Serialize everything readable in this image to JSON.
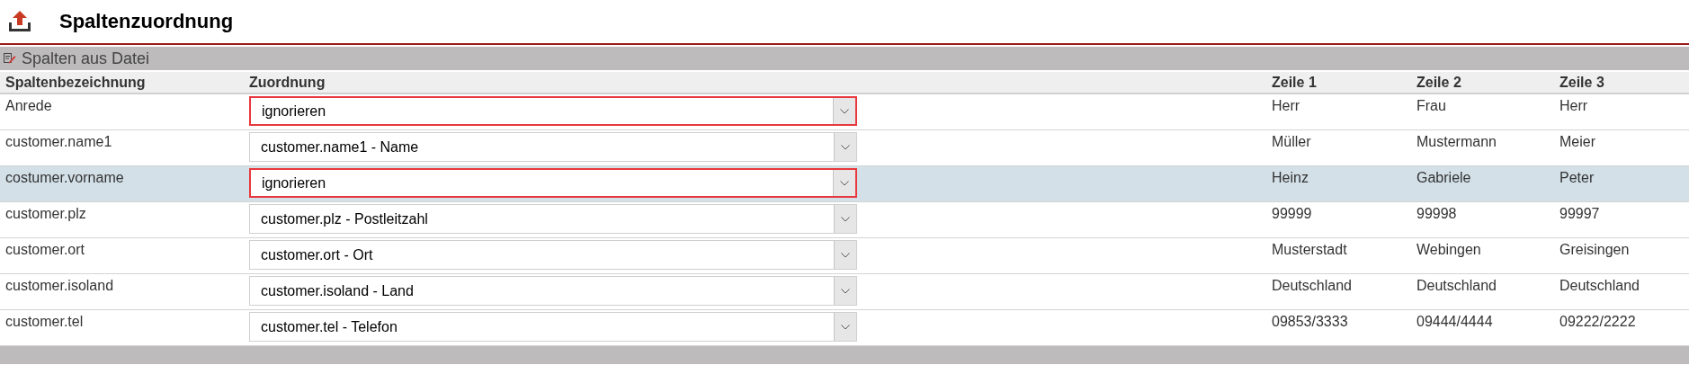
{
  "page": {
    "title": "Spaltenzuordnung"
  },
  "section": {
    "title": "Spalten aus Datei"
  },
  "table": {
    "columns": [
      "Spaltenbezeichnung",
      "Zuordnung",
      "Zeile 1",
      "Zeile 2",
      "Zeile 3"
    ],
    "rows": [
      {
        "name": "Anrede",
        "mapping": "ignorieren",
        "flagged": true,
        "selected": false,
        "values": [
          "Herr",
          "Frau",
          "Herr"
        ]
      },
      {
        "name": "customer.name1",
        "mapping": "customer.name1 - Name",
        "flagged": false,
        "selected": false,
        "values": [
          "Müller",
          "Mustermann",
          "Meier"
        ]
      },
      {
        "name": "costumer.vorname",
        "mapping": "ignorieren",
        "flagged": true,
        "selected": true,
        "values": [
          "Heinz",
          "Gabriele",
          "Peter"
        ]
      },
      {
        "name": "customer.plz",
        "mapping": "customer.plz - Postleitzahl",
        "flagged": false,
        "selected": false,
        "values": [
          "99999",
          "99998",
          "99997"
        ]
      },
      {
        "name": "customer.ort",
        "mapping": "customer.ort - Ort",
        "flagged": false,
        "selected": false,
        "values": [
          "Musterstadt",
          "Webingen",
          "Greisingen"
        ]
      },
      {
        "name": "customer.isoland",
        "mapping": "customer.isoland - Land",
        "flagged": false,
        "selected": false,
        "values": [
          "Deutschland",
          "Deutschland",
          "Deutschland"
        ]
      },
      {
        "name": "customer.tel",
        "mapping": "customer.tel - Telefon",
        "flagged": false,
        "selected": false,
        "values": [
          "09853/3333",
          "09444/4444",
          "09222/2222"
        ]
      }
    ]
  }
}
